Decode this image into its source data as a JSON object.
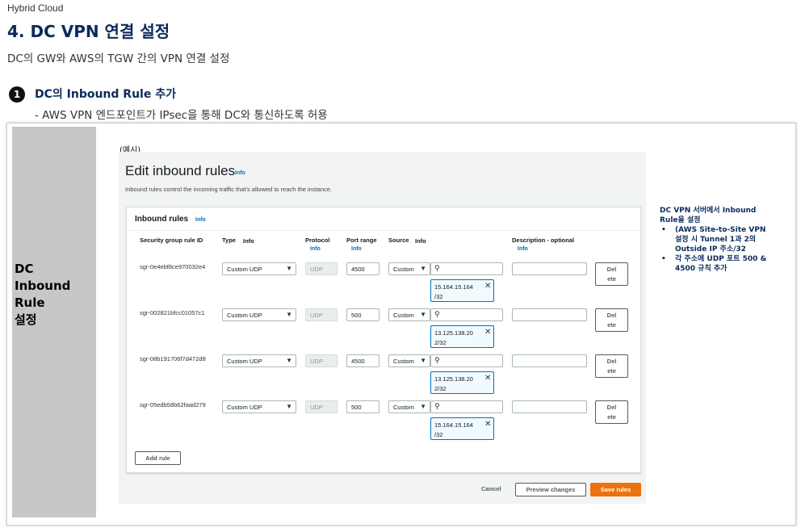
{
  "slide": {
    "top_label": "Hybrid Cloud",
    "title": "4. DC VPN 연결 설정",
    "subtitle": "DC의 GW와 AWS의 TGW 간의 VPN 연결 설정",
    "step_number": "1",
    "step_title": "DC의 Inbound Rule 추가",
    "step_desc": "- AWS VPN 엔드포인트가 IPsec을 통해 DC와 통신하도록 허용",
    "side_label": "DC\nInbound\nRule\n설정",
    "example_label": "(예시)"
  },
  "console": {
    "title": "Edit inbound rules",
    "info": "Info",
    "description": "Inbound rules control the incoming traffic that's allowed to reach the instance.",
    "panel_title": "Inbound rules",
    "columns": {
      "rule_id": "Security group rule ID",
      "type": "Type",
      "protocol": "Protocol",
      "port_range": "Port range",
      "source": "Source",
      "description": "Description - optional"
    },
    "rules": [
      {
        "id": "sgr-0e4ebf8ce970032e4",
        "type": "Custom UDP",
        "protocol": "UDP",
        "port": "4500",
        "source_type": "Custom",
        "cidr": "15.164.15.164\n/32",
        "delete": "Del\nete"
      },
      {
        "id": "sgr-002821bfcc01057c1",
        "type": "Custom UDP",
        "protocol": "UDP",
        "port": "500",
        "source_type": "Custom",
        "cidr": "13.125.138.20\n2/32",
        "delete": "Del\nete"
      },
      {
        "id": "sgr-08b191706f7d472d8",
        "type": "Custom UDP",
        "protocol": "UDP",
        "port": "4500",
        "source_type": "Custom",
        "cidr": "13.125.138.20\n2/32",
        "delete": "Del\nete"
      },
      {
        "id": "sgr-05edb58b62faad279",
        "type": "Custom UDP",
        "protocol": "UDP",
        "port": "500",
        "source_type": "Custom",
        "cidr": "15.164.15.164\n/32",
        "delete": "Del\nete"
      }
    ],
    "add_rule": "Add rule",
    "cancel": "Cancel",
    "preview": "Preview changes",
    "save": "Save rules",
    "accent_color": "#ec7211",
    "link_color": "#0073bb"
  },
  "note": {
    "heading": "DC VPN 서버에서 Inbound Rule을 설정",
    "bullets": [
      "(AWS Site-to-Site VPN 설정 시 Tunnel 1과 2의 Outside IP 주소/32",
      "각 주소에 UDP 포트 500 & 4500 규칙 추가"
    ]
  }
}
